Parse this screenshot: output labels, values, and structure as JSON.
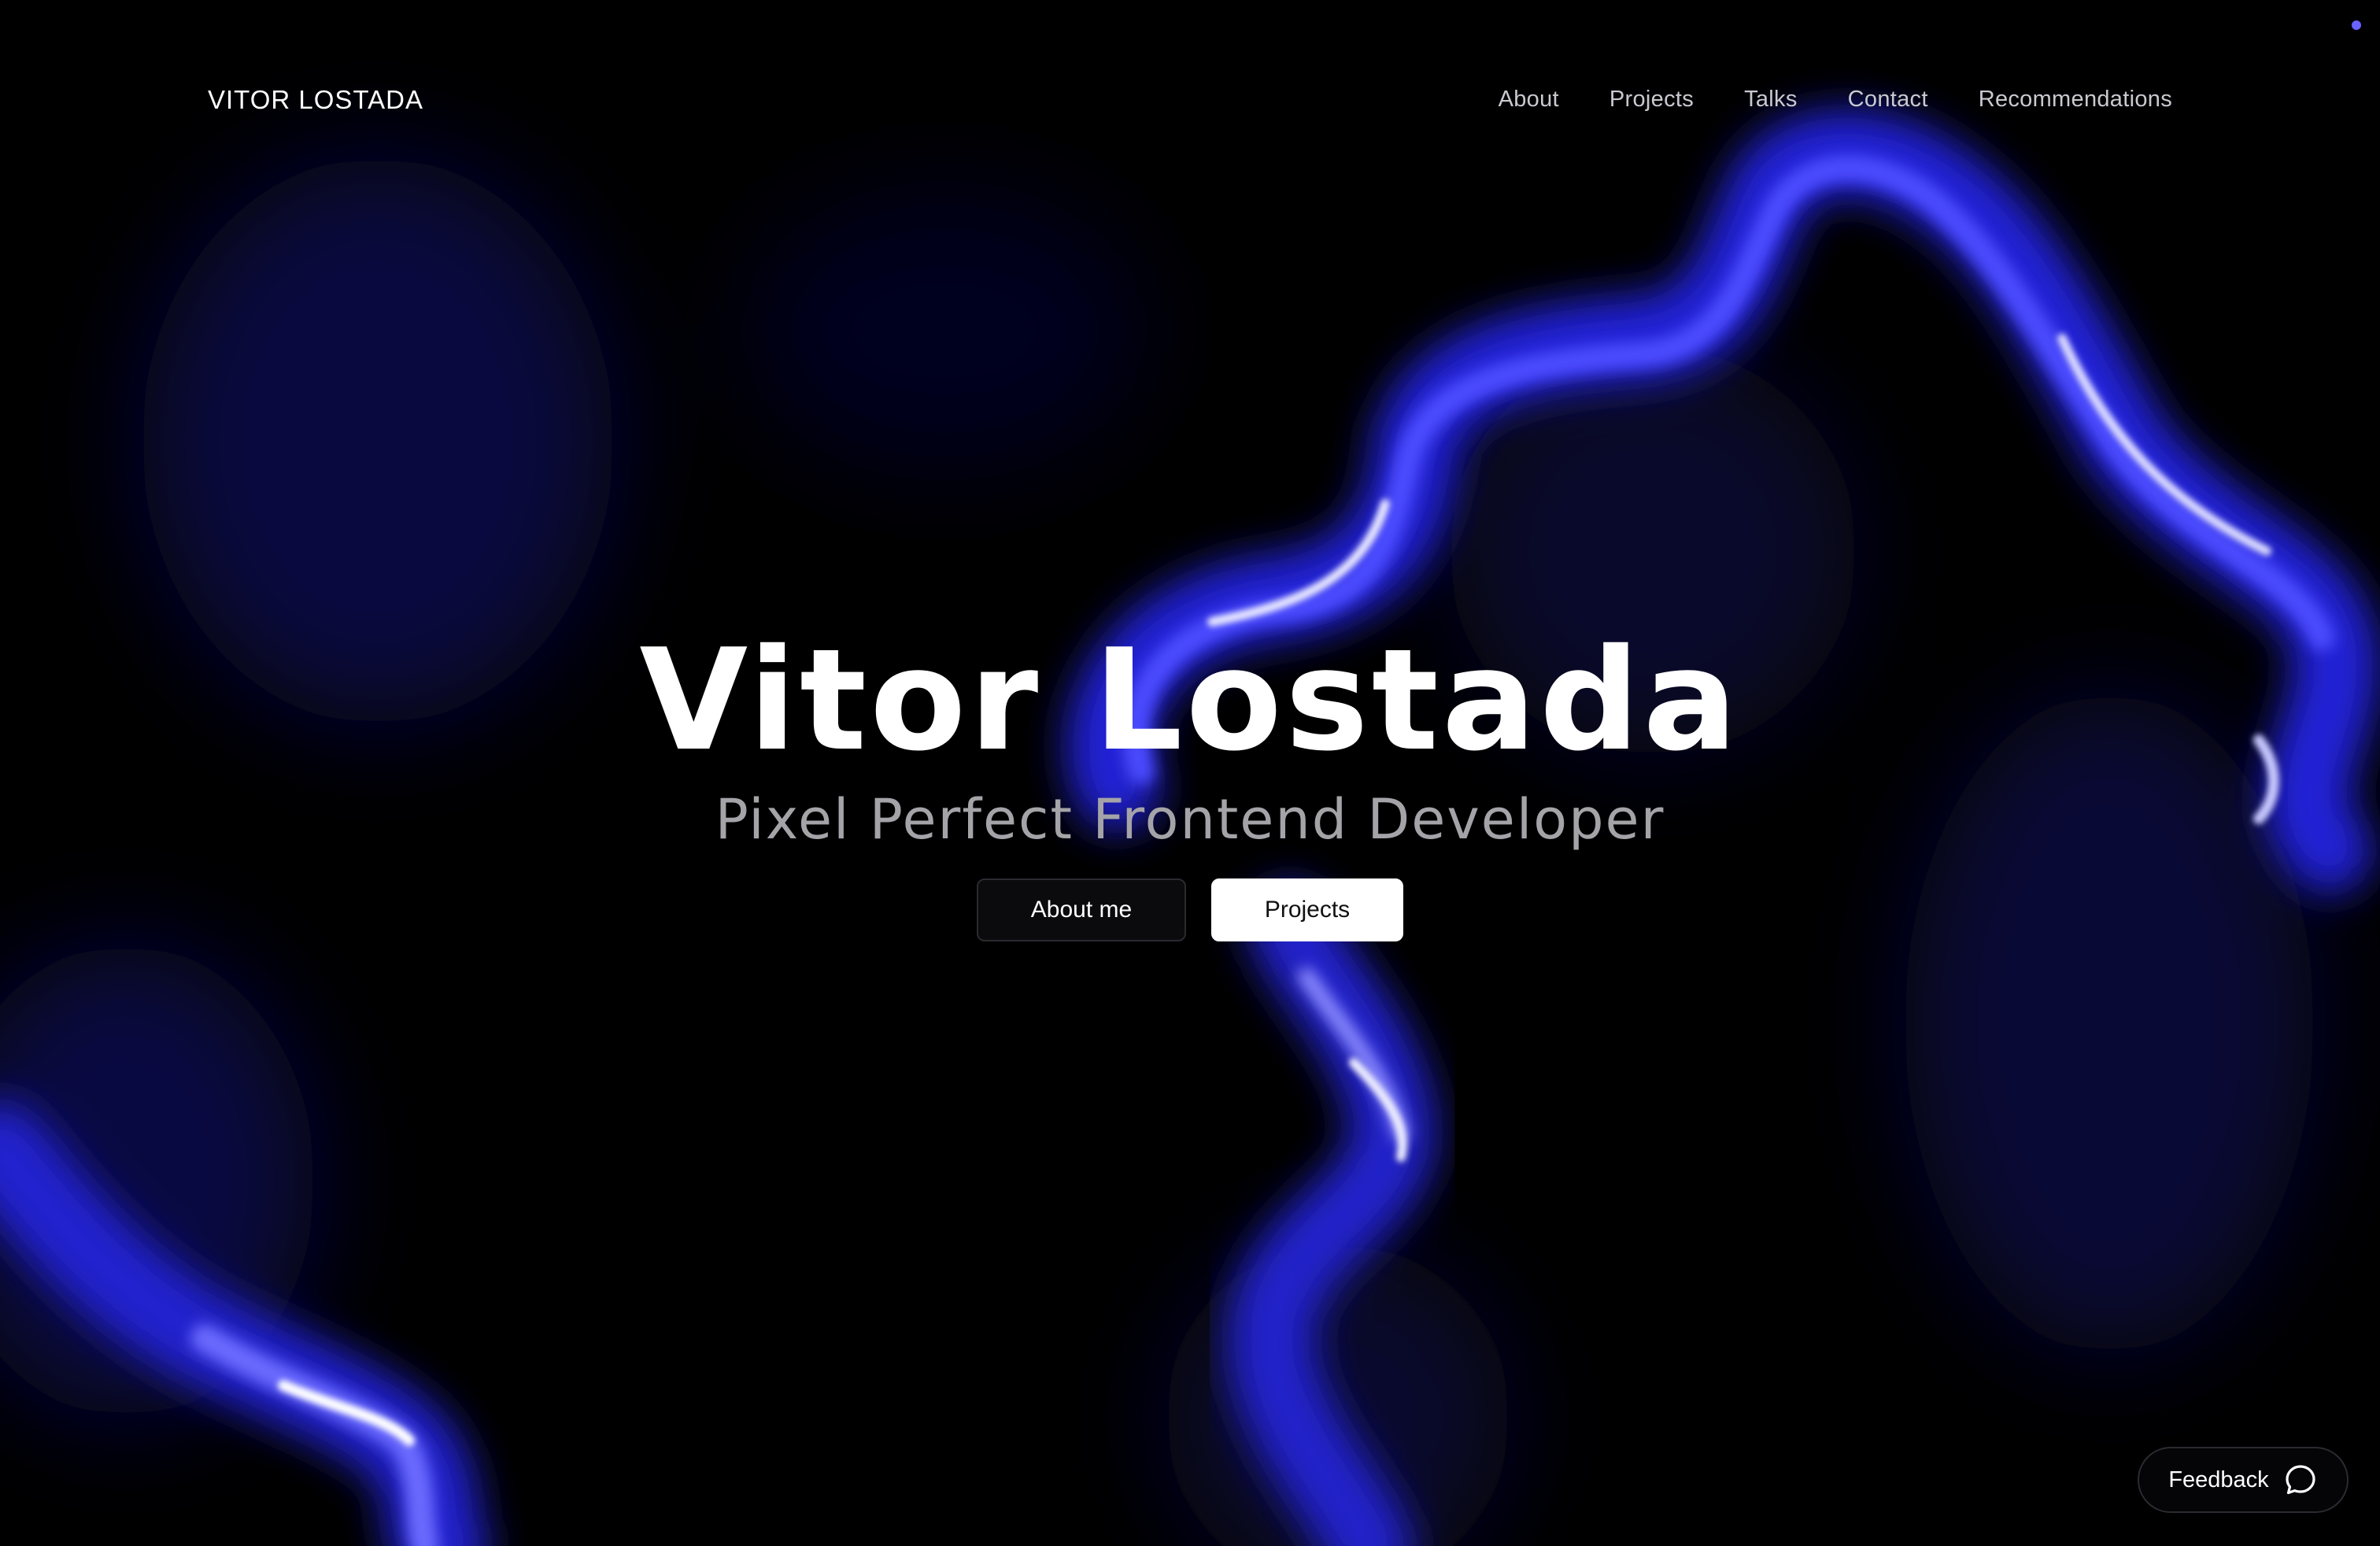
{
  "header": {
    "logo_text": "VITOR LOSTADA",
    "nav": [
      {
        "label": "About"
      },
      {
        "label": "Projects"
      },
      {
        "label": "Talks"
      },
      {
        "label": "Contact"
      },
      {
        "label": "Recommendations"
      }
    ]
  },
  "hero": {
    "title": "Vitor Lostada",
    "subtitle": "Pixel Perfect Frontend Developer",
    "primary_button_label": "About me",
    "secondary_button_label": "Projects"
  },
  "feedback": {
    "label": "Feedback",
    "icon": "chat-bubble-icon"
  },
  "theme": {
    "background": "#000000",
    "accent": "#2a2adf",
    "status_dot": "#6b63ff"
  }
}
